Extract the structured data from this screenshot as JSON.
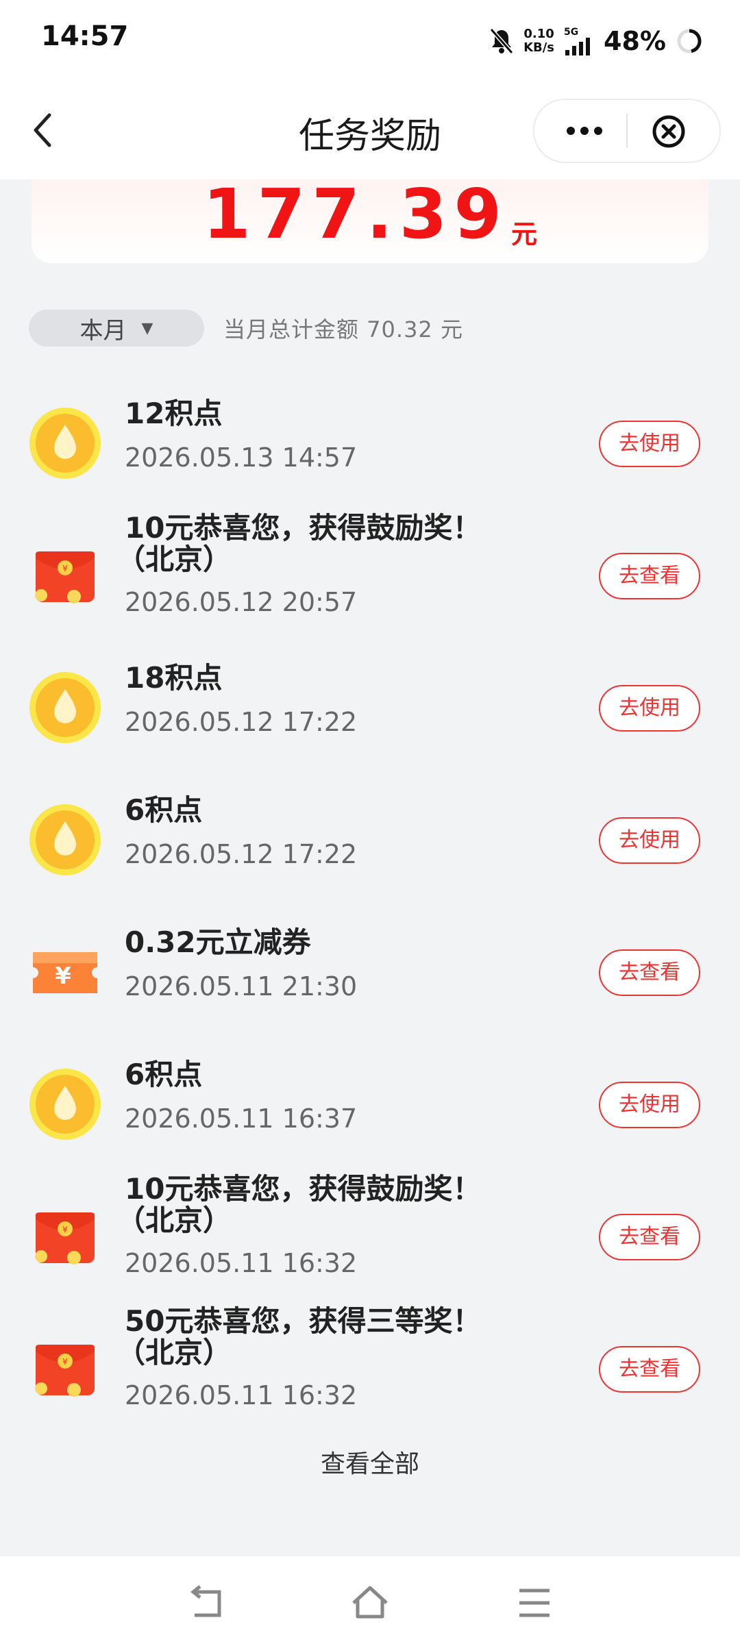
{
  "status_bar": {
    "time": "14:57",
    "net_speed_value": "0.10",
    "net_speed_unit": "KB/s",
    "signal_label": "5G",
    "battery": "48%",
    "icons": [
      "bell-muted-icon",
      "signal-icon",
      "battery-ring-icon"
    ]
  },
  "nav": {
    "title": "任务奖励",
    "icons": [
      "back-icon",
      "more-icon",
      "close-icon"
    ]
  },
  "summary": {
    "amount": "177.39",
    "unit": "元"
  },
  "filter": {
    "period": "本月",
    "month_total": "当月总计金额 70.32 元"
  },
  "records": [
    {
      "icon": "points-drop-icon",
      "title_line1": "12积点",
      "title_line2": "",
      "time": "2026.05.13 14:57",
      "action": "去使用"
    },
    {
      "icon": "red-envelope-icon",
      "title_line1": "10元恭喜您，获得鼓励奖！",
      "title_line2": "（北京）",
      "time": "2026.05.12 20:57",
      "action": "去查看"
    },
    {
      "icon": "points-drop-icon",
      "title_line1": "18积点",
      "title_line2": "",
      "time": "2026.05.12 17:22",
      "action": "去使用"
    },
    {
      "icon": "points-drop-icon",
      "title_line1": "6积点",
      "title_line2": "",
      "time": "2026.05.12 17:22",
      "action": "去使用"
    },
    {
      "icon": "coupon-icon",
      "title_line1": "0.32元立减券",
      "title_line2": "",
      "time": "2026.05.11 21:30",
      "action": "去查看"
    },
    {
      "icon": "points-drop-icon",
      "title_line1": "6积点",
      "title_line2": "",
      "time": "2026.05.11 16:37",
      "action": "去使用"
    },
    {
      "icon": "red-envelope-icon",
      "title_line1": "10元恭喜您，获得鼓励奖！",
      "title_line2": "（北京）",
      "time": "2026.05.11 16:32",
      "action": "去查看"
    },
    {
      "icon": "red-envelope-icon",
      "title_line1": "50元恭喜您，获得三等奖！",
      "title_line2": "（北京）",
      "time": "2026.05.11 16:32",
      "action": "去查看"
    }
  ],
  "view_all": "查看全部",
  "system_nav": {
    "icons": [
      "nav-back-icon",
      "nav-home-icon",
      "nav-menu-icon"
    ]
  },
  "colors": {
    "accent": "#f01414",
    "button_border": "#e33333",
    "background": "#f2f3f5"
  }
}
